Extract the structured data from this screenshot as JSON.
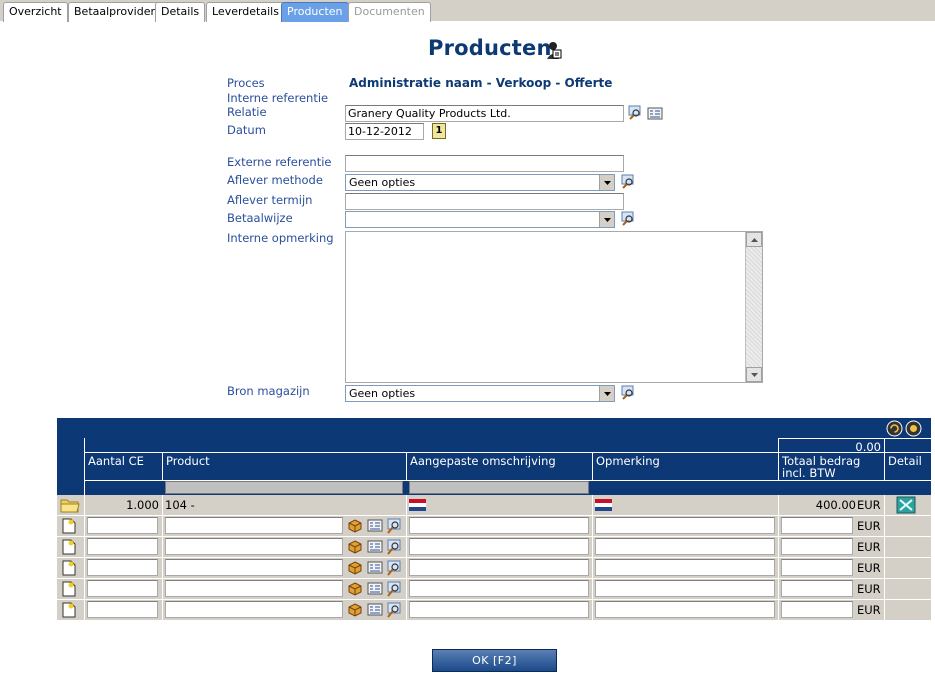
{
  "tabs": [
    {
      "label": "Overzicht",
      "state": "normal"
    },
    {
      "label": "Betaalprovider",
      "state": "normal"
    },
    {
      "label": "Details",
      "state": "normal"
    },
    {
      "label": "Leverdetails",
      "state": "normal"
    },
    {
      "label": "Producten",
      "state": "active"
    },
    {
      "label": "Documenten",
      "state": "disabled"
    }
  ],
  "page": {
    "title": "Producten"
  },
  "form": {
    "proces_label": "Proces",
    "proces_value": "Administratie naam - Verkoop - Offerte",
    "interne_ref_label": "Interne referentie",
    "relatie_label": "Relatie",
    "relatie_value": "Granery Quality Products Ltd.",
    "datum_label": "Datum",
    "datum_value": "10-12-2012",
    "datum_day": "1",
    "externe_ref_label": "Externe referentie",
    "externe_ref_value": "",
    "aflever_methode_label": "Aflever methode",
    "aflever_methode_value": "Geen opties",
    "aflever_termijn_label": "Aflever termijn",
    "aflever_termijn_value": "",
    "betaalwijze_label": "Betaalwijze",
    "betaalwijze_value": "",
    "interne_opm_label": "Interne opmerking",
    "interne_opm_value": "",
    "bron_magazijn_label": "Bron magazijn",
    "bron_magazijn_value": "Geen opties"
  },
  "grid": {
    "total": "0.00",
    "columns": {
      "aantal": "Aantal CE",
      "product": "Product",
      "omschrijving": "Aangepaste omschrijving",
      "opmerking": "Opmerking",
      "totaal": "Totaal bedrag incl. BTW",
      "detail": "Detail"
    },
    "row": {
      "aantal": "1.000",
      "product": "104 -",
      "totaal": "400.00",
      "currency": "EUR"
    },
    "currency": "EUR"
  },
  "buttons": {
    "ok": "OK [F2]"
  },
  "colors": {
    "header": "#0d3876",
    "active_tab": "#6aa0e8",
    "title": "#0e3a74",
    "label": "#2a4f9a"
  }
}
